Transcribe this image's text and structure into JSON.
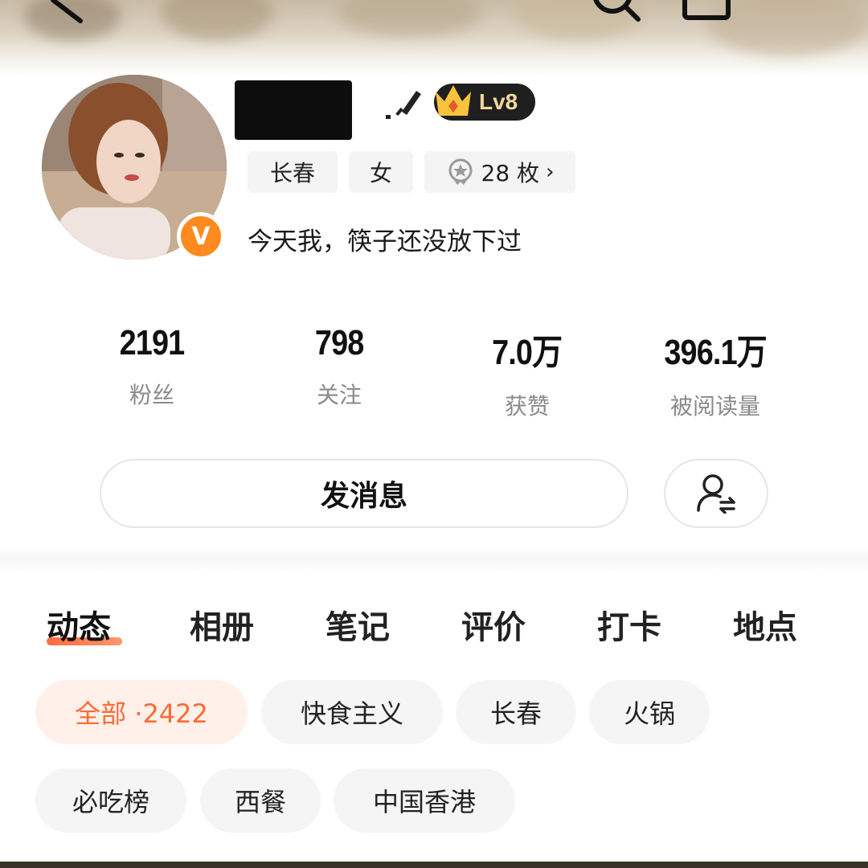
{
  "header": {
    "back_icon": "back-arrow-icon",
    "search_icon": "search-icon",
    "share_icon": "share-icon"
  },
  "profile": {
    "username": "",
    "level": "Lv8",
    "verified_letter": "V",
    "tags": {
      "city": "长春",
      "gender": "女",
      "medals": "28 枚"
    },
    "bio": "今天我，筷子还没放下过"
  },
  "stats": [
    {
      "value": "2191",
      "label": "粉丝"
    },
    {
      "value": "798",
      "label": "关注"
    },
    {
      "value": "7.0万",
      "label": "获赞"
    },
    {
      "value": "396.1万",
      "label": "被阅读量"
    }
  ],
  "actions": {
    "message_label": "发消息",
    "follow_icon": "user-follow-icon"
  },
  "tabs": [
    {
      "label": "动态",
      "active": true
    },
    {
      "label": "相册",
      "active": false
    },
    {
      "label": "笔记",
      "active": false
    },
    {
      "label": "评价",
      "active": false
    },
    {
      "label": "打卡",
      "active": false
    },
    {
      "label": "地点",
      "active": false
    }
  ],
  "filters": [
    {
      "label": "全部 ·2422",
      "active": true
    },
    {
      "label": "快食主义",
      "active": false
    },
    {
      "label": "长春",
      "active": false
    },
    {
      "label": "火锅",
      "active": false
    },
    {
      "label": "必吃榜",
      "active": false
    },
    {
      "label": "西餐",
      "active": false
    },
    {
      "label": "中国香港",
      "active": false
    }
  ],
  "colors": {
    "accent": "#ff6a36",
    "verified": "#ff8a1e",
    "level_badge_bg": "#1f1f1f",
    "level_text": "#f3d79b"
  }
}
